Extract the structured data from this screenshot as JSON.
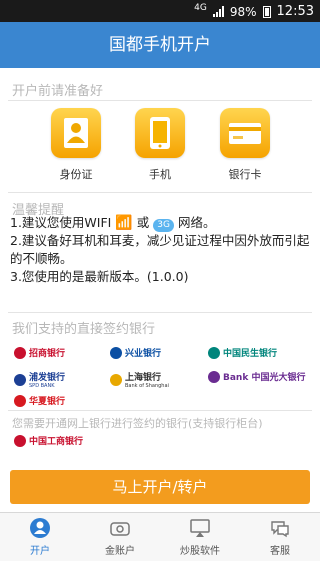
{
  "status_bar": {
    "network": "4G",
    "battery": "98%",
    "time": "12:53"
  },
  "header": {
    "title": "国都手机开户"
  },
  "prepare": {
    "title": "开户前请准备好",
    "items": [
      {
        "label": "身份证",
        "icon": "id-card-icon"
      },
      {
        "label": "手机",
        "icon": "phone-icon"
      },
      {
        "label": "银行卡",
        "icon": "bank-card-icon"
      }
    ]
  },
  "tips": {
    "title": "温馨提醒",
    "line1_a": "1.建议您使用WIFI",
    "line1_or": "或",
    "line1_3g": "3G",
    "line1_b": "网络。",
    "line2": "2.建议备好耳机和耳麦，减少见证过程中因外放而引起的不顺畅。",
    "line3": "3.您使用的是最新版本。(1.0.0)"
  },
  "banks": {
    "direct_title": "我们支持的直接签约银行",
    "direct": [
      {
        "name": "招商银行",
        "color": "#c8102e"
      },
      {
        "name": "兴业银行",
        "color": "#0b4fa3"
      },
      {
        "name": "中国民生银行",
        "color": "#00857c"
      },
      {
        "name": "浦发银行",
        "sub": "SPD BANK",
        "color": "#1c3f94"
      },
      {
        "name": "上海银行",
        "sub": "Bank of Shanghai",
        "color": "#e8a800"
      },
      {
        "name": "Bank 中国光大银行",
        "color": "#6a2c91"
      },
      {
        "name": "华夏银行",
        "color": "#d71920"
      }
    ],
    "online_title": "您需要开通网上银行进行签约的银行(支持银行柜台)",
    "online": [
      {
        "name": "中国工商银行",
        "color": "#c8102e"
      }
    ]
  },
  "cta": {
    "label": "马上开户/转户"
  },
  "tabs": [
    {
      "label": "开户",
      "icon": "user-circle-icon",
      "active": true
    },
    {
      "label": "金账户",
      "icon": "wallet-icon",
      "active": false
    },
    {
      "label": "炒股软件",
      "icon": "monitor-icon",
      "active": false
    },
    {
      "label": "客服",
      "icon": "chat-icon",
      "active": false
    }
  ],
  "colors": {
    "header": "#3a86d0",
    "accent": "#f39c1e",
    "tab_active": "#2d7cd1"
  }
}
